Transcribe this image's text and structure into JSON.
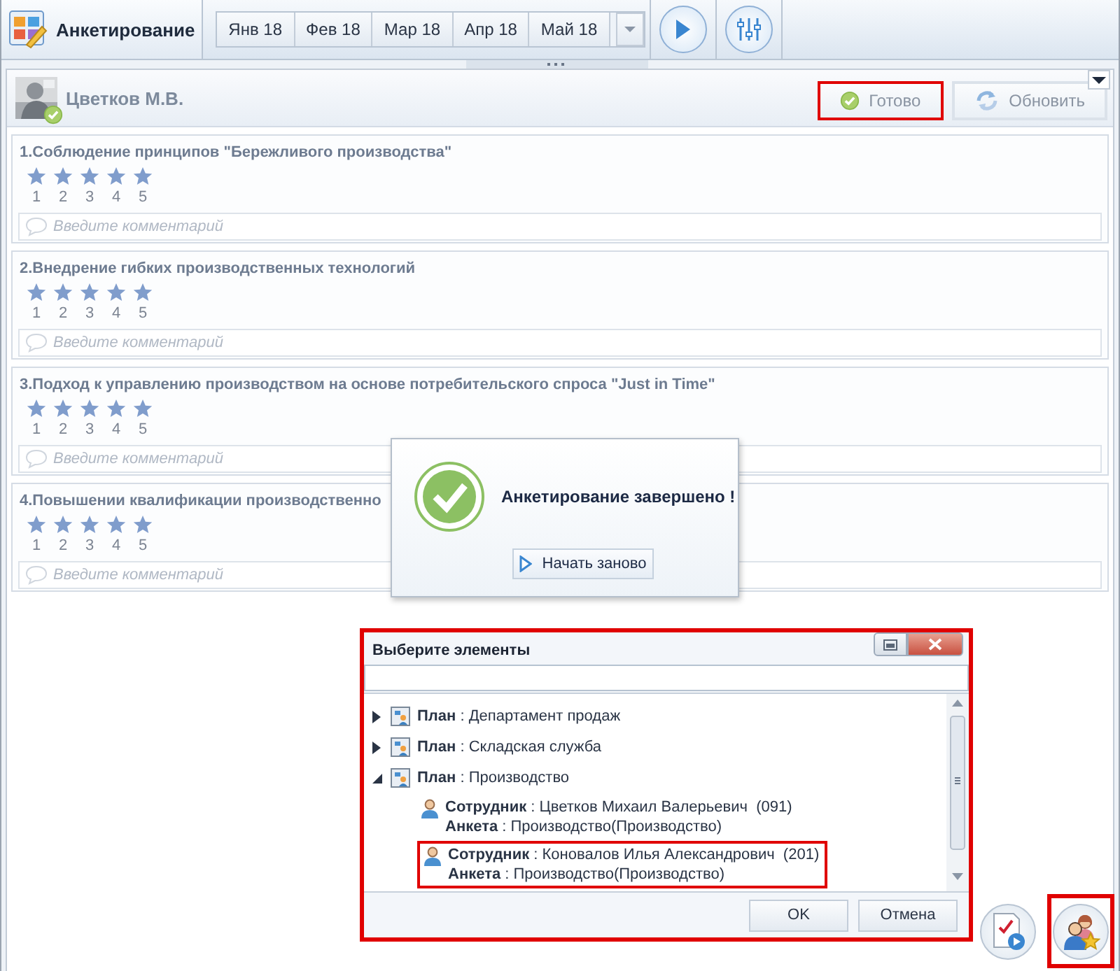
{
  "app": {
    "title": "Анкетирование"
  },
  "months": [
    {
      "label": "Янв 18",
      "selected": false
    },
    {
      "label": "Фев 18",
      "selected": false
    },
    {
      "label": "Мар 18",
      "selected": false
    },
    {
      "label": "Апр 18",
      "selected": false
    },
    {
      "label": "Май 18",
      "selected": false
    }
  ],
  "respondent": {
    "name": "Цветков М.В.",
    "completed": true
  },
  "actions": [
    {
      "kind": "done",
      "label": "Готово",
      "highlighted": true
    },
    {
      "kind": "refresh",
      "label": "Обновить",
      "highlighted": false
    }
  ],
  "questions": [
    {
      "title": "1.Соблюдение принципов \"Бережливого производства\"",
      "stars": 5,
      "scale": [
        "1",
        "2",
        "3",
        "4",
        "5"
      ],
      "placeholder": "Введите комментарий"
    },
    {
      "title": "2.Внедрение гибких производственных технологий",
      "stars": 5,
      "scale": [
        "1",
        "2",
        "3",
        "4",
        "5"
      ],
      "placeholder": "Введите комментарий"
    },
    {
      "title": "3.Подход к управлению производством на основе потребительского спроса \"Just in Time\"",
      "stars": 5,
      "scale": [
        "1",
        "2",
        "3",
        "4",
        "5"
      ],
      "placeholder": "Введите комментарий"
    },
    {
      "title": "4.Повышении квалификации производственно",
      "stars": 5,
      "scale": [
        "1",
        "2",
        "3",
        "4",
        "5"
      ],
      "placeholder": "Введите комментарий"
    }
  ],
  "popup": {
    "message": "Анкетирование завершено !",
    "button": "Начать заново"
  },
  "dialog": {
    "title": "Выберите элементы",
    "highlighted": true,
    "tree": [
      {
        "kind": "plan",
        "line": "**План** : Департамент продаж",
        "expanded": false,
        "selected": false
      },
      {
        "kind": "plan",
        "line": "**План** : Складская служба",
        "expanded": false,
        "selected": false
      },
      {
        "kind": "plan",
        "line": "**План** : Производство",
        "expanded": true,
        "selected": false,
        "children": [
          {
            "kind": "employee",
            "line": "**Сотрудник** : Цветков Михаил Валерьевич  (091)",
            "survey": "**Анкета** : Производство(Производство)",
            "selected": false
          },
          {
            "kind": "employee",
            "line": "**Сотрудник** : Коновалов Илья Александрович  (201)",
            "survey": "**Анкета** : Производство(Производство)",
            "selected": true
          }
        ]
      }
    ],
    "buttons": [
      "OK",
      "Отмена"
    ]
  },
  "float_buttons": [
    {
      "kind": "report",
      "highlighted": false
    },
    {
      "kind": "people",
      "highlighted": true
    }
  ]
}
